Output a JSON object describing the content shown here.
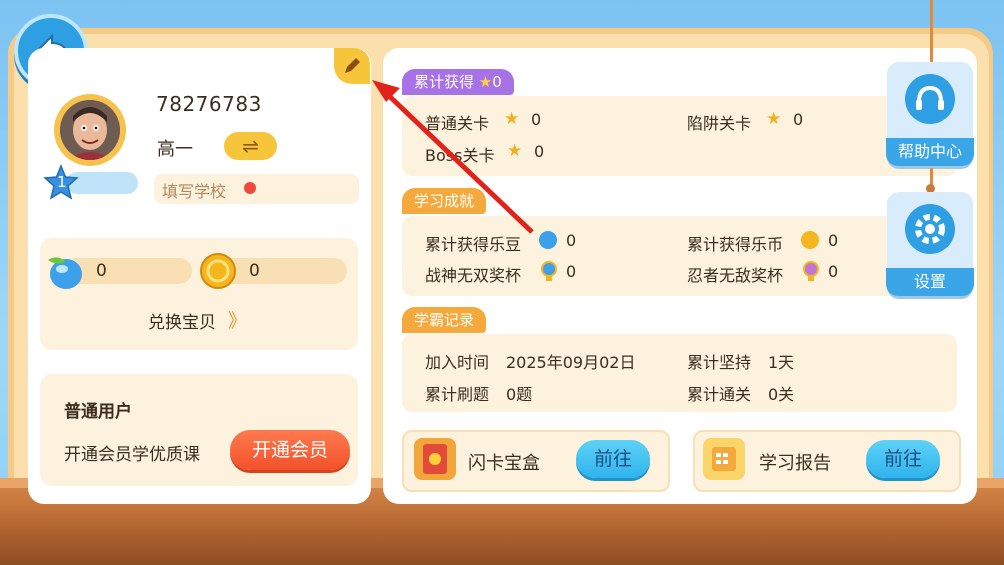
{
  "profile": {
    "user_id": "78276783",
    "grade": "高一",
    "switch_icon": "⇌",
    "level": "1",
    "school_placeholder": "填写学校"
  },
  "wallet": {
    "beans": "0",
    "coins": "0",
    "exchange_label": "兑换宝贝",
    "exchange_arrows": "》"
  },
  "membership": {
    "title": "普通用户",
    "desc": "开通会员学优质课",
    "button": "开通会员"
  },
  "cumulative": {
    "tab_label": "累计获得",
    "tab_count": "0",
    "normal_label": "普通关卡",
    "normal_val": "0",
    "trap_label": "陷阱关卡",
    "trap_val": "0",
    "boss_label": "Boss关卡",
    "boss_val": "0"
  },
  "achievements": {
    "tab_label": "学习成就",
    "beans_label": "累计获得乐豆",
    "beans_val": "0",
    "coins_label": "累计获得乐币",
    "coins_val": "0",
    "warrior_label": "战神无双奖杯",
    "warrior_val": "0",
    "ninja_label": "忍者无敌奖杯",
    "ninja_val": "0"
  },
  "records": {
    "tab_label": "学霸记录",
    "join_label": "加入时间",
    "join_val": "2025年09月02日",
    "persist_label": "累计坚持",
    "persist_val": "1天",
    "questions_label": "累计刷题",
    "questions_val": "0题",
    "passed_label": "累计通关",
    "passed_val": "0关"
  },
  "tools": {
    "flashcard_label": "闪卡宝盒",
    "flashcard_go": "前往",
    "report_label": "学习报告",
    "report_go": "前往"
  },
  "side": {
    "help_label": "帮助中心",
    "settings_label": "设置"
  },
  "colors": {
    "accent_blue": "#2f9fe4",
    "accent_orange": "#f5a83b",
    "accent_purple": "#a772e6",
    "member_red": "#f2512b"
  }
}
